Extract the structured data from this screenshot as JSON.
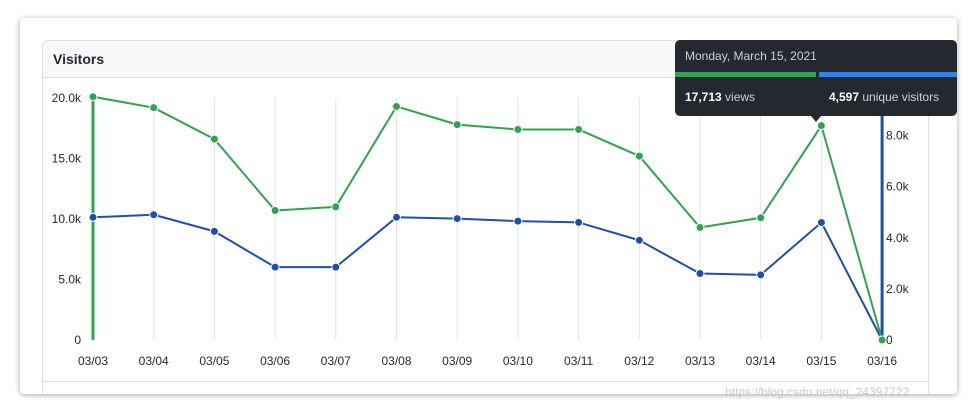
{
  "panel": {
    "title": "Visitors"
  },
  "tooltip": {
    "date": "Monday, March 15, 2021",
    "views_value": "17,713",
    "views_label": "views",
    "unique_value": "4,597",
    "unique_label": "unique visitors"
  },
  "watermark": "https://blog.csdn.net/qq_24397722",
  "colors": {
    "views": "#2da44e",
    "unique": "#1f4fae",
    "accent_blue": "#2f81f7"
  },
  "chart_data": {
    "type": "line",
    "categories": [
      "03/03",
      "03/04",
      "03/05",
      "03/06",
      "03/07",
      "03/08",
      "03/09",
      "03/10",
      "03/11",
      "03/12",
      "03/13",
      "03/14",
      "03/15",
      "03/16"
    ],
    "series": [
      {
        "name": "views",
        "axis": "left",
        "color": "#2da44e",
        "values": [
          20100,
          19200,
          16600,
          10700,
          11000,
          19300,
          17800,
          17400,
          17400,
          15200,
          9300,
          10100,
          17713,
          0
        ]
      },
      {
        "name": "unique visitors",
        "axis": "right",
        "color": "#1f4fae",
        "values": [
          4800,
          4900,
          4250,
          2850,
          2850,
          4800,
          4750,
          4650,
          4600,
          3900,
          2600,
          2550,
          4597,
          0
        ]
      }
    ],
    "y_left": {
      "ticks": [
        "0",
        "5.0k",
        "10.0k",
        "15.0k",
        "20.0k"
      ],
      "tick_values": [
        0,
        5000,
        10000,
        15000,
        20000
      ],
      "lim": [
        0,
        20000
      ]
    },
    "y_right": {
      "ticks": [
        "0",
        "2.0k",
        "4.0k",
        "6.0k",
        "8.0k"
      ],
      "tick_values": [
        0,
        2000,
        4000,
        6000,
        8000
      ],
      "lim": [
        0,
        9200
      ]
    },
    "grid": "vertical"
  }
}
